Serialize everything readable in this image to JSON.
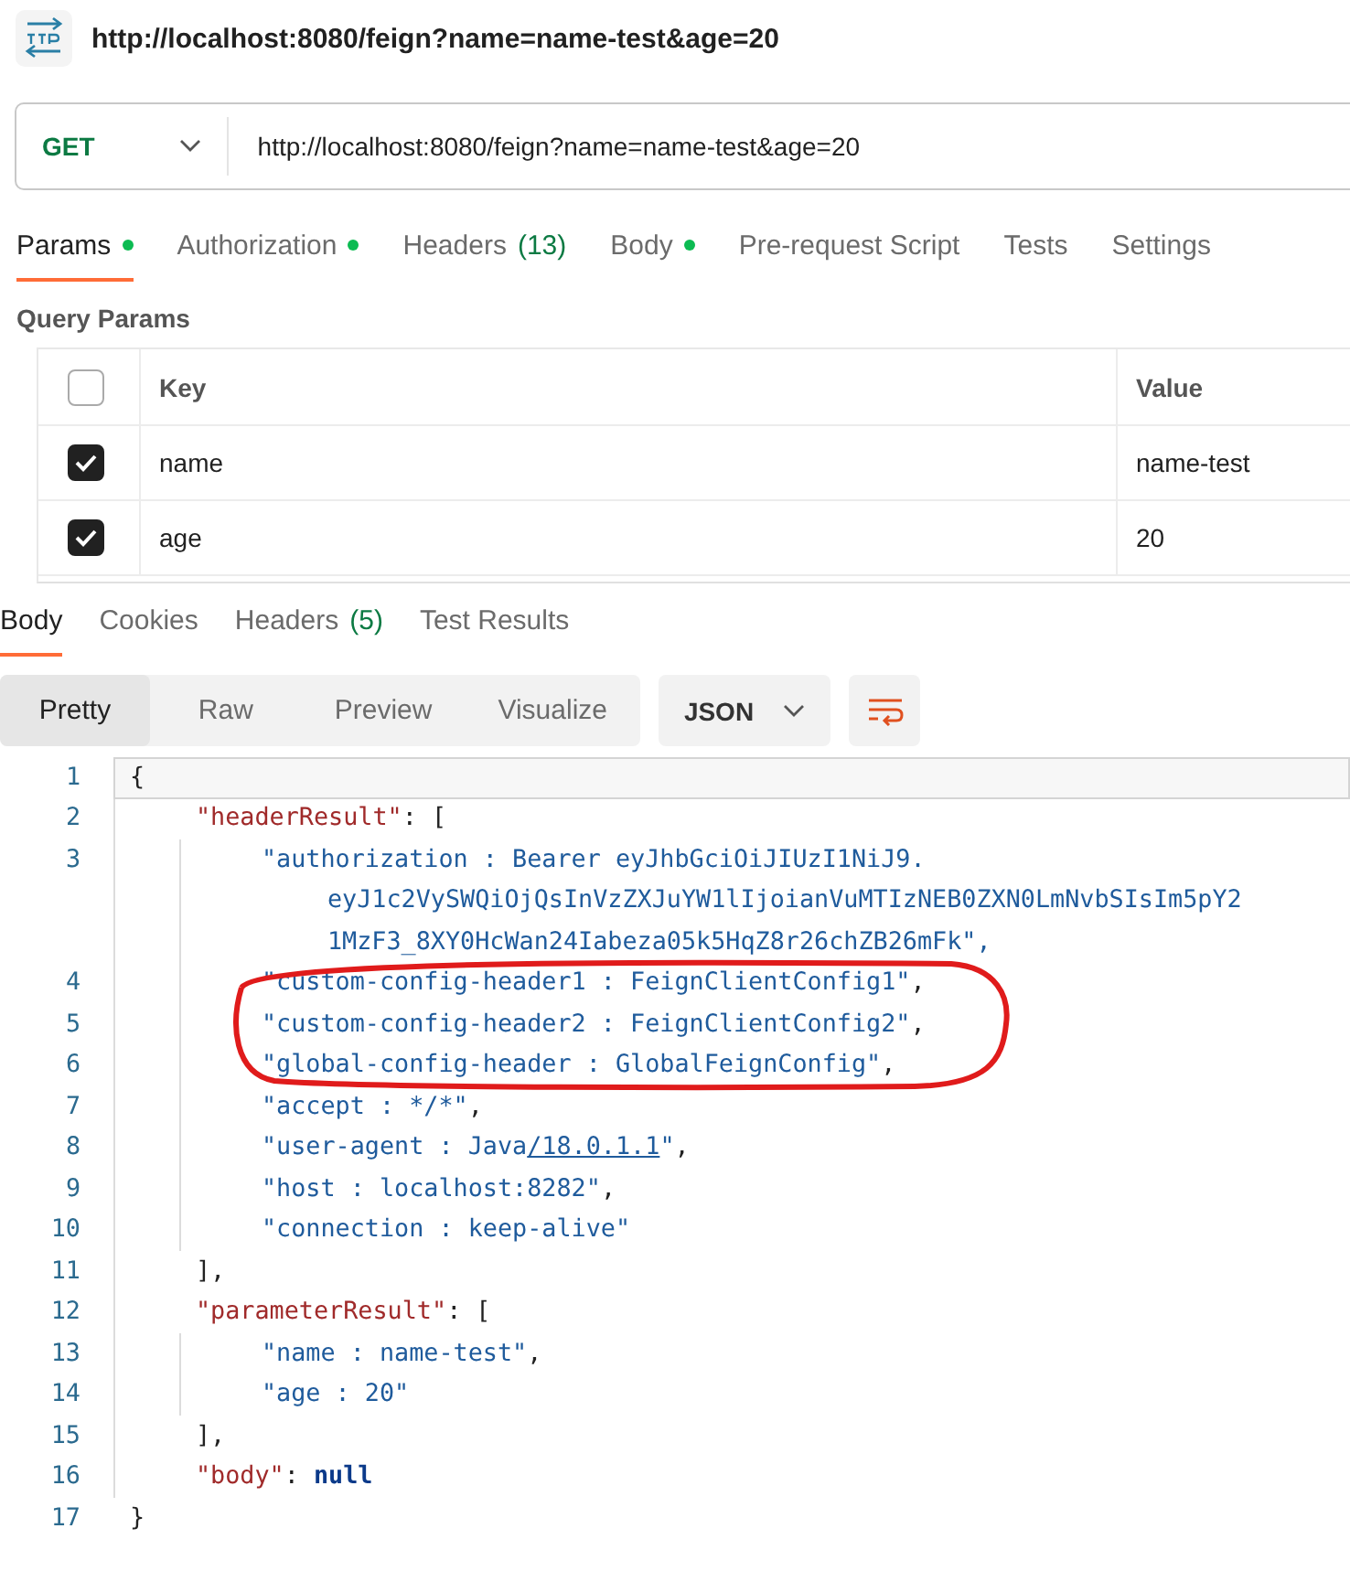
{
  "request_title": "http://localhost:8080/feign?name=name-test&age=20",
  "request": {
    "method": "GET",
    "url": "http://localhost:8080/feign?name=name-test&age=20"
  },
  "request_tabs": [
    {
      "label": "Params",
      "dot": true,
      "selected": true
    },
    {
      "label": "Authorization",
      "dot": true,
      "selected": false
    },
    {
      "label": "Headers",
      "count": "(13)",
      "dot": false,
      "selected": false
    },
    {
      "label": "Body",
      "dot": true,
      "selected": false
    },
    {
      "label": "Pre-request Script",
      "dot": false,
      "selected": false
    },
    {
      "label": "Tests",
      "dot": false,
      "selected": false
    },
    {
      "label": "Settings",
      "dot": false,
      "selected": false
    }
  ],
  "query_params": {
    "title": "Query Params",
    "columns": [
      "Key",
      "Value"
    ],
    "all_checked": false,
    "rows": [
      {
        "checked": true,
        "key": "name",
        "value": "name-test"
      },
      {
        "checked": true,
        "key": "age",
        "value": "20"
      }
    ]
  },
  "response_tabs": [
    {
      "label": "Body",
      "selected": true
    },
    {
      "label": "Cookies",
      "selected": false
    },
    {
      "label": "Headers",
      "count": "(5)",
      "selected": false
    },
    {
      "label": "Test Results",
      "selected": false
    }
  ],
  "view_modes": [
    {
      "label": "Pretty",
      "selected": true
    },
    {
      "label": "Raw",
      "selected": false
    },
    {
      "label": "Preview",
      "selected": false
    },
    {
      "label": "Visualize",
      "selected": false
    }
  ],
  "format": "JSON",
  "code_lines": [
    {
      "number": "1",
      "active": true,
      "tokens": [
        {
          "kind": "punct",
          "text": "{"
        }
      ],
      "children": [
        {
          "number": "2",
          "active": false,
          "tokens": [
            {
              "kind": "key",
              "text": "\"headerResult\""
            },
            {
              "kind": "punct",
              "text": ": ["
            }
          ],
          "children": [
            {
              "number": "3",
              "active": false,
              "tokens": [
                {
                  "kind": "string",
                  "text": "\"authorization : Bearer eyJhbGciOiJIUzI1NiJ9."
                }
              ],
              "continuation": [
                "eyJ1c2VySWQiOjQsInVzZXJuYW1lIjoianVuMTIzNEB0ZXN0LmNvbSIsIm5pY2",
                "1MzF3_8XY0HcWan24Iabeza05k5HqZ8r26chZB26mFk\","
              ]
            },
            {
              "number": "4",
              "active": false,
              "tokens": [
                {
                  "kind": "string",
                  "text": "\"custom-config-header1 : FeignClientConfig1\""
                },
                {
                  "kind": "punct",
                  "text": ","
                }
              ]
            },
            {
              "number": "5",
              "active": false,
              "tokens": [
                {
                  "kind": "string",
                  "text": "\"custom-config-header2 : FeignClientConfig2\""
                },
                {
                  "kind": "punct",
                  "text": ","
                }
              ]
            },
            {
              "number": "6",
              "active": false,
              "tokens": [
                {
                  "kind": "string",
                  "text": "\"global-config-header : GlobalFeignConfig\""
                },
                {
                  "kind": "punct",
                  "text": ","
                }
              ]
            },
            {
              "number": "7",
              "active": false,
              "tokens": [
                {
                  "kind": "string",
                  "text": "\"accept : */*\""
                },
                {
                  "kind": "punct",
                  "text": ","
                }
              ]
            },
            {
              "number": "8",
              "active": false,
              "tokens": [
                {
                  "kind": "string",
                  "text": "\"user-agent : Java"
                },
                {
                  "kind": "link",
                  "text": "/18.0.1.1"
                },
                {
                  "kind": "string",
                  "text": "\""
                },
                {
                  "kind": "punct",
                  "text": ","
                }
              ]
            },
            {
              "number": "9",
              "active": false,
              "tokens": [
                {
                  "kind": "string",
                  "text": "\"host : localhost:8282\""
                },
                {
                  "kind": "punct",
                  "text": ","
                }
              ]
            },
            {
              "number": "10",
              "active": false,
              "tokens": [
                {
                  "kind": "string",
                  "text": "\"connection : keep-alive\""
                }
              ]
            }
          ]
        },
        {
          "number": "11",
          "active": false,
          "tokens": [
            {
              "kind": "punct",
              "text": "],"
            }
          ]
        },
        {
          "number": "12",
          "active": false,
          "tokens": [
            {
              "kind": "key",
              "text": "\"parameterResult\""
            },
            {
              "kind": "punct",
              "text": ": ["
            }
          ],
          "children": [
            {
              "number": "13",
              "active": false,
              "tokens": [
                {
                  "kind": "string",
                  "text": "\"name : name-test\""
                },
                {
                  "kind": "punct",
                  "text": ","
                }
              ]
            },
            {
              "number": "14",
              "active": false,
              "tokens": [
                {
                  "kind": "string",
                  "text": "\"age : 20\""
                }
              ]
            }
          ]
        },
        {
          "number": "15",
          "active": false,
          "tokens": [
            {
              "kind": "punct",
              "text": "],"
            }
          ]
        },
        {
          "number": "16",
          "active": false,
          "tokens": [
            {
              "kind": "key",
              "text": "\"body\""
            },
            {
              "kind": "punct",
              "text": ": "
            },
            {
              "kind": "keyword",
              "text": "null"
            }
          ]
        }
      ]
    },
    {
      "number": "17",
      "active": false,
      "tokens": [
        {
          "kind": "punct",
          "text": "}"
        }
      ]
    }
  ]
}
